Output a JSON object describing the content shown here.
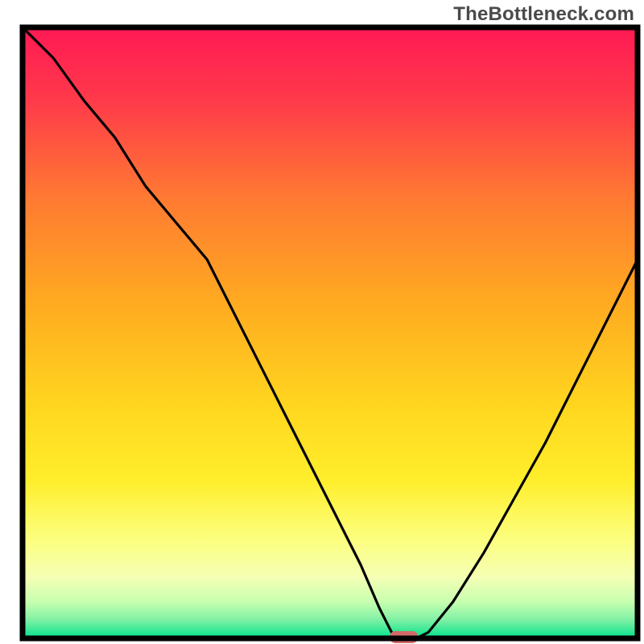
{
  "watermark": "TheBottleneck.com",
  "chart_data": {
    "type": "line",
    "title": "",
    "xlabel": "",
    "ylabel": "",
    "xlim": [
      0,
      100
    ],
    "ylim": [
      0,
      100
    ],
    "grid": false,
    "legend": false,
    "marker": {
      "x": 62,
      "y": 0,
      "color": "#d36a68"
    },
    "series": [
      {
        "name": "curve",
        "x": [
          0,
          5,
          10,
          15,
          20,
          25,
          30,
          35,
          40,
          45,
          50,
          55,
          58,
          60,
          62,
          64,
          66,
          70,
          75,
          80,
          85,
          90,
          95,
          100
        ],
        "values": [
          100,
          95,
          88,
          82,
          74,
          68,
          62,
          52,
          42,
          32,
          22,
          12,
          5,
          1,
          0,
          0,
          1,
          6,
          14,
          23,
          32,
          42,
          52,
          62
        ]
      }
    ],
    "background_bands": [
      {
        "from": 100,
        "to": 78,
        "fill_top": "#ff1954",
        "fill_bottom": "#ff5a3b"
      },
      {
        "from": 78,
        "to": 52,
        "fill_top": "#ff5a3b",
        "fill_bottom": "#ffae1f"
      },
      {
        "from": 52,
        "to": 28,
        "fill_top": "#ffae1f",
        "fill_bottom": "#ffee2b"
      },
      {
        "from": 28,
        "to": 12,
        "fill_top": "#ffee2b",
        "fill_bottom": "#fdff9a"
      },
      {
        "from": 12,
        "to": 5,
        "fill_top": "#fdff9a",
        "fill_bottom": "#b8ff9e"
      },
      {
        "from": 5,
        "to": 0,
        "fill_top": "#b8ff9e",
        "fill_bottom": "#00e48c"
      }
    ]
  }
}
